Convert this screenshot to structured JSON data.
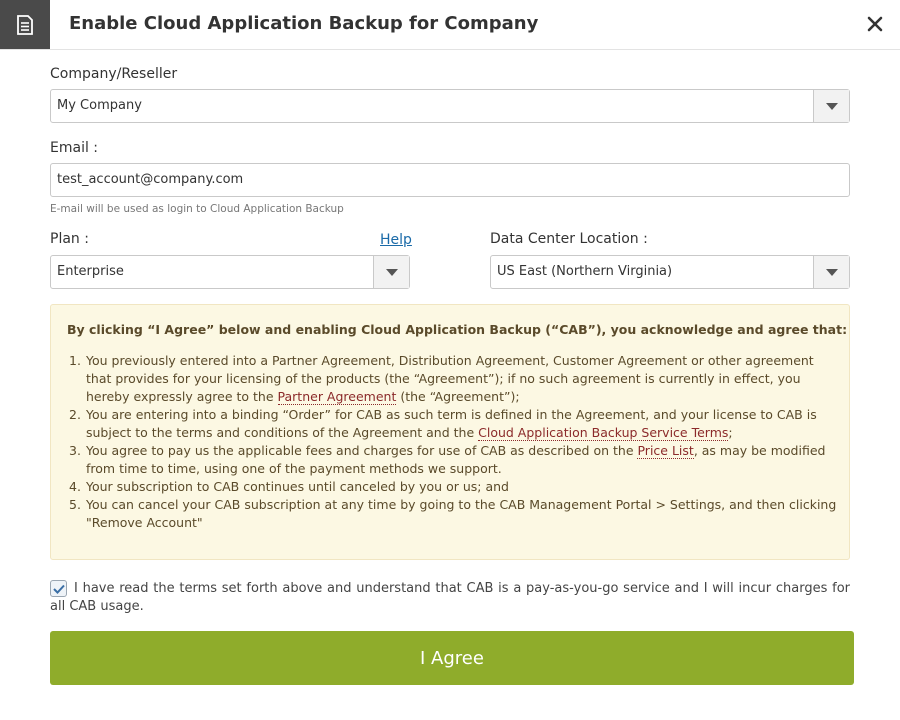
{
  "dialog": {
    "title": "Enable Cloud Application Backup for Company",
    "header_icon": "document-list-icon",
    "close_icon": "close-icon"
  },
  "company": {
    "label": "Company/Reseller",
    "value": "My Company"
  },
  "email": {
    "label": "Email :",
    "value": "test_account@company.com",
    "hint": "E-mail will be used as login to Cloud Application Backup"
  },
  "plan": {
    "label": "Plan :",
    "help_link": "Help",
    "value": "Enterprise"
  },
  "datacenter": {
    "label": "Data Center Location :",
    "value": "US East (Northern Virginia)"
  },
  "terms": {
    "heading": "By clicking “I Agree” below and enabling Cloud Application Backup (“CAB”), you acknowledge and agree that:",
    "items": [
      {
        "num": "1.",
        "text_before": "You previously entered into a Partner Agreement, Distribution Agreement, Customer Agreement or other agreement that provides for your licensing of the products (the “Agreement”); if no such agreement is currently in effect, you hereby expressly agree to the ",
        "link": "Partner Agreement",
        "text_after": " (the “Agreement”);"
      },
      {
        "num": "2.",
        "text_before": "You are entering into a binding “Order” for CAB as such term is defined in the Agreement, and your license to CAB is subject to the terms and conditions of the Agreement and the ",
        "link": "Cloud Application Backup Service Terms",
        "text_after": ";"
      },
      {
        "num": "3.",
        "text_before": "You agree to pay us the applicable fees and charges for use of CAB as described on the ",
        "link": "Price List",
        "text_after": ", as may be modified from time to time, using one of the payment methods we support."
      },
      {
        "num": "4.",
        "text_before": "Your subscription to CAB continues until canceled by you or us; and"
      },
      {
        "num": "5.",
        "text_before": "You can cancel your CAB subscription at any time by going to the CAB Management Portal > Settings, and then clicking \"Remove Account\""
      }
    ]
  },
  "acknowledge": {
    "checked": true,
    "text": "I have read the terms set forth above and understand that CAB is a pay-as-you-go service and I will incur charges for all CAB usage."
  },
  "agree_button": {
    "label": "I Agree"
  },
  "colors": {
    "header_icon_bg": "#4a4a4a",
    "terms_bg": "#fcf8e3",
    "terms_text": "#5a4a2a",
    "link_red": "#8b2a2a",
    "help_blue": "#1a6aa8",
    "agree_green": "#8fac2b"
  }
}
